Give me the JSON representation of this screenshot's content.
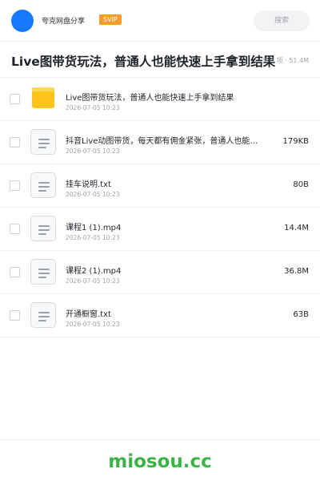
{
  "header": {
    "sharer_name": "夸克网盘分享",
    "badge": "SVIP",
    "search_placeholder": "搜索"
  },
  "share": {
    "title": "Live图带货玩法，普通人也能快速上手拿到结果",
    "summary": "共 6 项 · 51.4M"
  },
  "files": [
    {
      "icon": "folder-icon",
      "name": "Live图带货玩法，普通人也能快速上手拿到结果",
      "date": "2026-07-05 10:23",
      "size": ""
    },
    {
      "icon": "file-icon",
      "name": "抖音Live动图带货，每天都有佣金紧张，普通人也能…",
      "date": "2026-07-05 10:23",
      "size": "179KB"
    },
    {
      "icon": "file-icon",
      "name": "挂车说明.txt",
      "date": "2026-07-05 10:23",
      "size": "80B"
    },
    {
      "icon": "file-icon",
      "name": "课程1 (1).mp4",
      "date": "2026-07-05 10:23",
      "size": "14.4M"
    },
    {
      "icon": "file-icon",
      "name": "课程2 (1).mp4",
      "date": "2026-07-05 10:23",
      "size": "36.8M"
    },
    {
      "icon": "file-icon",
      "name": "开通橱窗.txt",
      "date": "2026-07-05 10:23",
      "size": "63B"
    }
  ],
  "footer": {
    "watermark": "miosou.cc"
  },
  "colors": {
    "avatar": "#1677ff",
    "svip_badge": "#f39b2b",
    "folder": "#ffc31a",
    "watermark": "#3cb349"
  }
}
